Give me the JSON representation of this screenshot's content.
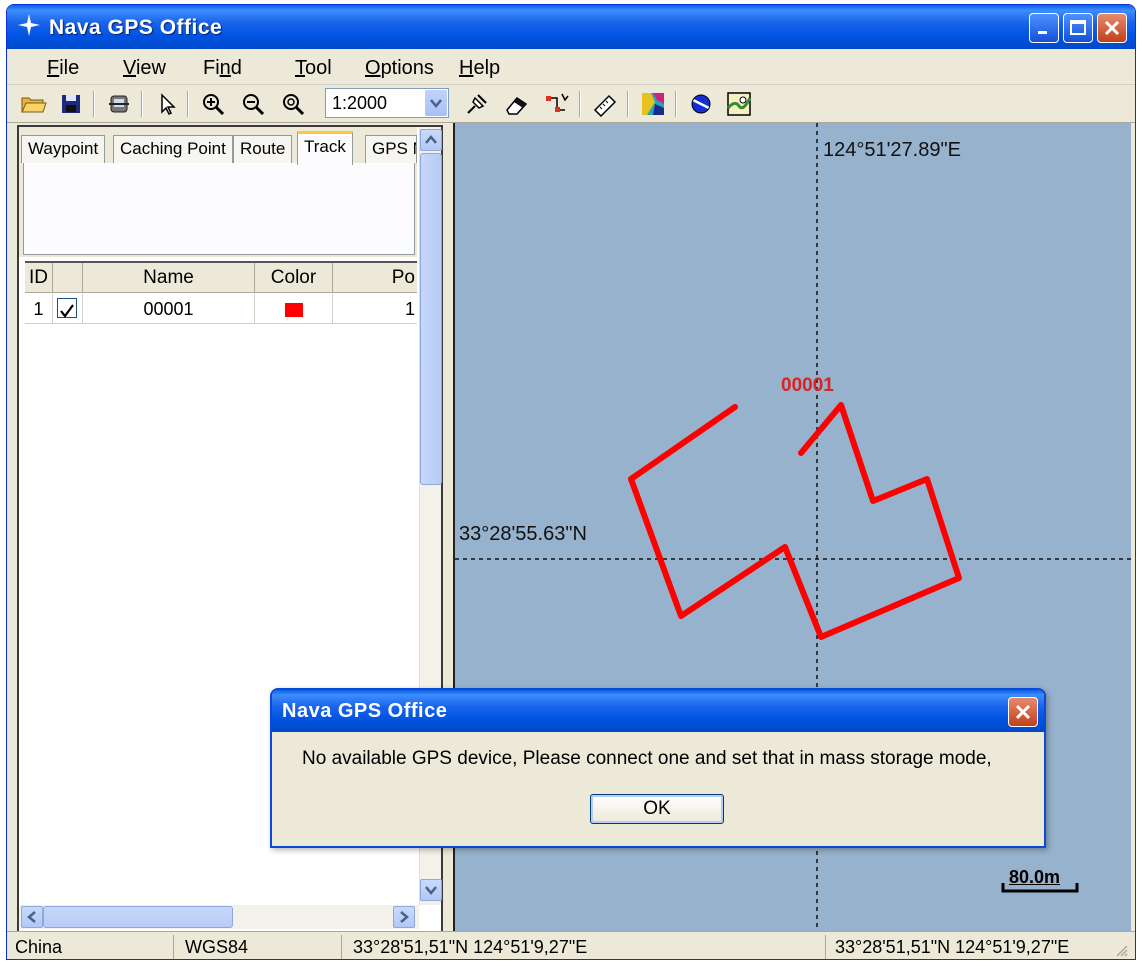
{
  "window": {
    "title": "Nava GPS Office"
  },
  "menu": {
    "items": [
      {
        "label": "File",
        "mnemonic": "F",
        "rest": "ile"
      },
      {
        "label": "View",
        "mnemonic": "V",
        "rest": "iew"
      },
      {
        "label": "Find",
        "pre": "Fi",
        "mnemonic": "n",
        "rest": "d"
      },
      {
        "label": "Tool",
        "mnemonic": "T",
        "rest": "ool"
      },
      {
        "label": "Options",
        "mnemonic": "O",
        "rest": "ptions"
      },
      {
        "label": "Help",
        "mnemonic": "H",
        "rest": "elp"
      }
    ]
  },
  "toolbar": {
    "scale_value": "1:2000",
    "icons": [
      "open-folder-icon",
      "save-icon",
      "gps-device-icon",
      "pointer-icon",
      "zoom-in-icon",
      "zoom-out-icon",
      "zoom-fit-icon",
      "add-waypoint-icon",
      "eraser-icon",
      "route-icon",
      "ruler-icon",
      "map-color-icon",
      "globe-icon",
      "map-view-icon"
    ]
  },
  "tabs": [
    {
      "label": "Waypoint",
      "active": false
    },
    {
      "label": "Caching Point",
      "active": false
    },
    {
      "label": "Route",
      "active": false
    },
    {
      "label": "Track",
      "active": true
    },
    {
      "label": "GPS M",
      "active": false
    }
  ],
  "grid": {
    "headers": [
      "ID",
      "Name",
      "Color",
      "Po"
    ],
    "rows": [
      {
        "id": "1",
        "checked": true,
        "name": "00001",
        "color": "#ff0000",
        "points": "1"
      }
    ]
  },
  "map": {
    "longitude_label": "124°51'27.89\"E",
    "latitude_label": "33°28'55.63\"N",
    "track_name": "00001",
    "track_color": "#ff0000",
    "background": "#97b2cc",
    "scale_bar": "80.0m"
  },
  "status": {
    "region": "China",
    "datum": "WGS84",
    "coord1": "33°28'51,51\"N  124°51'9,27\"E",
    "coord2": "33°28'51,51\"N  124°51'9,27\"E"
  },
  "dialog": {
    "title": "Nava GPS Office",
    "message": "No available GPS device, Please connect one and set that in mass storage mode,",
    "ok_label": "OK"
  }
}
